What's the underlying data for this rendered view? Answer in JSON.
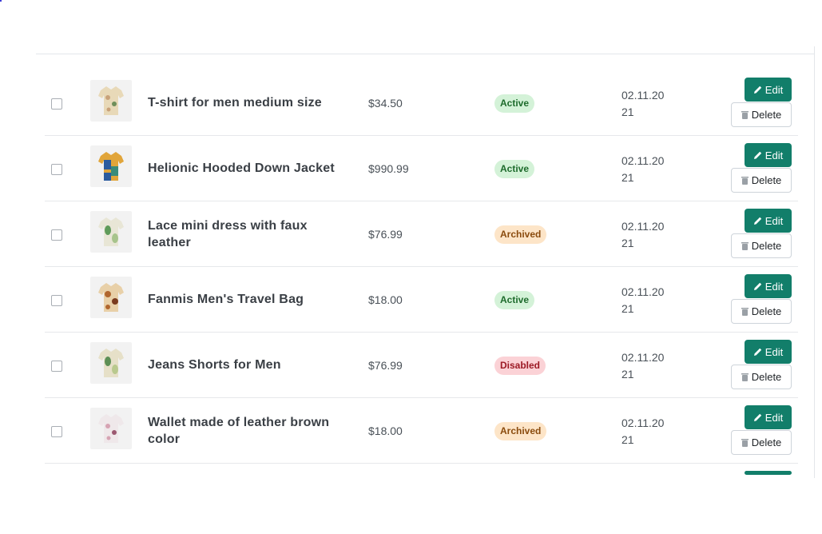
{
  "products": [
    {
      "name": "T-shirt for men medium size",
      "price": "$34.50",
      "status": "Active",
      "status_type": "active",
      "date": "02.11.2021",
      "thumb_colors": [
        "#c8a27a",
        "#e8d9b8",
        "#6f8f5a"
      ]
    },
    {
      "name": "Helionic Hooded Down Jacket",
      "price": "$990.99",
      "status": "Active",
      "status_type": "active",
      "date": "02.11.2021",
      "thumb_colors": [
        "#2b5b9e",
        "#e1a53a",
        "#3a8b7a"
      ]
    },
    {
      "name": "Lace mini dress with faux leather",
      "price": "$76.99",
      "status": "Archived",
      "status_type": "archived",
      "date": "02.11.2021",
      "thumb_colors": [
        "#e8e6d6",
        "#5f9b5a",
        "#a7c48c"
      ]
    },
    {
      "name": "Fanmis Men's Travel Bag",
      "price": "$18.00",
      "status": "Active",
      "status_type": "active",
      "date": "02.11.2021",
      "thumb_colors": [
        "#b0662e",
        "#e8d0a8",
        "#7a3b1e"
      ]
    },
    {
      "name": "Jeans Shorts for Men",
      "price": "$76.99",
      "status": "Disabled",
      "status_type": "disabled",
      "date": "02.11.2021",
      "thumb_colors": [
        "#e6e0c8",
        "#5d8f55",
        "#b9c98e"
      ]
    },
    {
      "name": "Wallet made of leather brown color",
      "price": "$18.00",
      "status": "Archived",
      "status_type": "archived",
      "date": "02.11.2021",
      "thumb_colors": [
        "#efe8ea",
        "#d6a3b3",
        "#9b5870"
      ]
    }
  ],
  "actions": {
    "edit_label": "Edit",
    "delete_label": "Delete"
  },
  "icons": {
    "edit": "pencil-icon",
    "delete": "trash-icon"
  },
  "colors": {
    "edit_button": "#127e6a",
    "active_bg": "#d4f2d8",
    "archived_bg": "#fde5c8",
    "disabled_bg": "#fbd2d6"
  }
}
